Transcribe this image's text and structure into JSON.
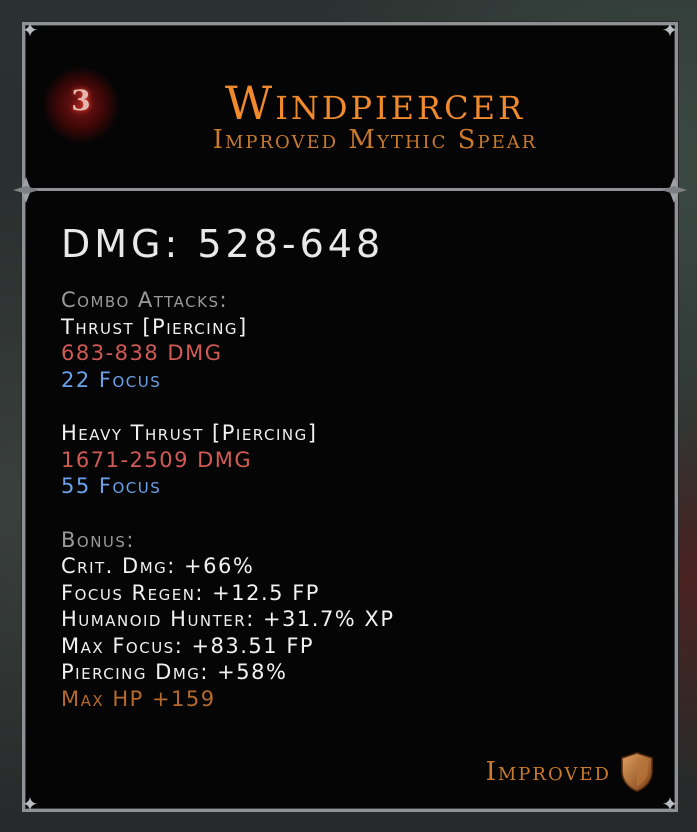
{
  "item": {
    "tier": "3",
    "name": "Windpiercer",
    "subtitle": "Improved Mythic Spear",
    "damage": "DMG: 528-648"
  },
  "combo": {
    "header": "Combo Attacks:",
    "attacks": [
      {
        "name": "Thrust [Piercing]",
        "damage": "683-838 DMG",
        "focus": "22 Focus"
      },
      {
        "name": "Heavy Thrust [Piercing]",
        "damage": "1671-2509 DMG",
        "focus": "55 Focus"
      }
    ]
  },
  "bonus": {
    "header": "Bonus:",
    "stats": [
      "Crit. Dmg: +66%",
      "Focus Regen: +12.5 FP",
      "Humanoid Hunter: +31.7% XP",
      "Max Focus: +83.51 FP",
      "Piercing Dmg: +58%"
    ],
    "special": "Max HP +159"
  },
  "footer": {
    "label": "Improved",
    "icon": "shield-icon"
  },
  "colors": {
    "title": "#f08a2c",
    "damage": "#d25a55",
    "focus": "#6aa1e8",
    "label": "#9a9a9a",
    "special": "#b36a2c",
    "border": "#8e9196"
  }
}
